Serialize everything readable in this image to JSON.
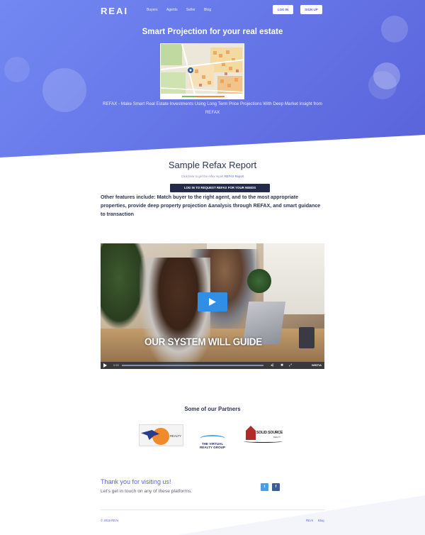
{
  "nav": {
    "logo": "REAI",
    "links": [
      "Buyers",
      "Agents",
      "Seller",
      "Blog"
    ],
    "login_label": "LOG IN",
    "signup_label": "SIGN UP"
  },
  "hero": {
    "title": "Smart Projection for your real estate",
    "description": "REFAX - Make Smart Real Estate Investments Using Long Term Price Projections With Deep Market Insight from REFAX",
    "map_image": "refax-map-preview"
  },
  "sample": {
    "title": "Sample Refax Report",
    "subtitle_prefix": "Click here to get the refax report",
    "subtitle_link": "REFAX Report",
    "cta_label": "LOG IN TO REQUEST REFAX FOR YOUR NEEDS",
    "features": "Other features include: Match buyer to the right agent, and to the most appropriate properties, provide deep property projection &analysis through REFAX, and smart guidance to transaction"
  },
  "video": {
    "caption": "OUR SYSTEM WILL GUIDE",
    "time": "0:53",
    "brand": "WISTIA",
    "accent": "#2f8fe6"
  },
  "partners": {
    "title": "Some of our Partners",
    "logos": [
      {
        "name": "partner-realty-logo",
        "text": "REALTY"
      },
      {
        "name": "virtual-realty-group-logo",
        "line1": "THE VIRTUAL",
        "line2": "REALTY GROUP"
      },
      {
        "name": "solid-source-realty-logo",
        "line1": "SOLID SOURCE",
        "line2": "REALTY"
      }
    ]
  },
  "footer": {
    "thanks": "Thank you for visiting us!",
    "touch": "Let's get in touch on any of these platforms.",
    "twitter_icon": "twitter-icon",
    "facebook_icon": "facebook-icon",
    "copyright": "© 2019 REAI",
    "links": [
      "REAI",
      "Blog"
    ],
    "accent": "#5a63da"
  }
}
